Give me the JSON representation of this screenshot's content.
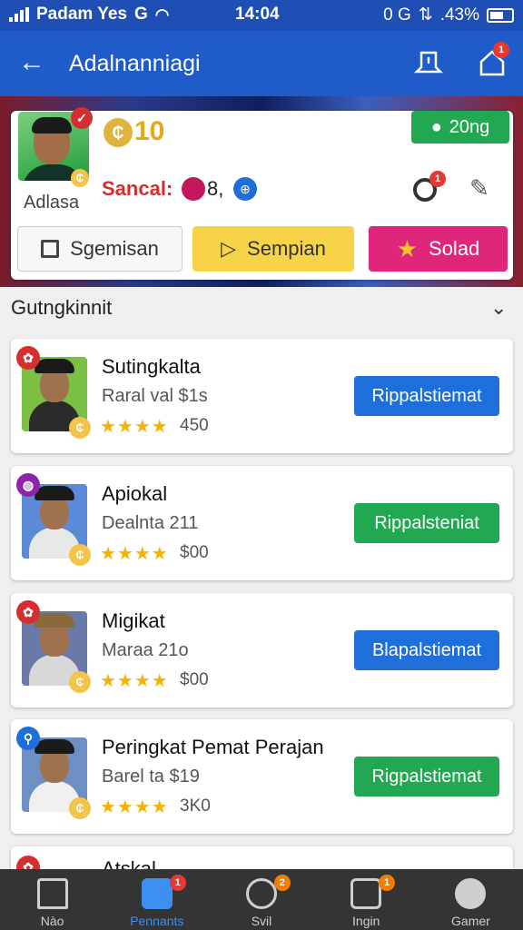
{
  "status": {
    "carrier": "Padam Yes",
    "net": "G",
    "time": "14:04",
    "right_net": "0 G",
    "battery": ".43%"
  },
  "appbar": {
    "title": "Adalnanniagi",
    "notif_badge": "1"
  },
  "profile": {
    "name": "Adlasa",
    "coins": "10",
    "level_badge": "20ng",
    "stats_label": "Sancal:",
    "stats_value": "8,",
    "circle_badge": "1",
    "buttons": [
      {
        "label": "Sgemisan",
        "icon": "checkbox-icon"
      },
      {
        "label": "Sempian",
        "icon": "play-icon"
      },
      {
        "label": "Solad",
        "icon": "star-icon"
      }
    ]
  },
  "section": {
    "title": "Gutngkinnit"
  },
  "items": [
    {
      "title": "Sutingkalta",
      "subtitle": "Raral val $1s",
      "stars": "★★★★",
      "rating": "450",
      "action": "Rippalstiemat",
      "action_color": "#1e6fd9",
      "cat_color": "#d32f2f",
      "cat_icon": "rose-icon",
      "bg": "#7cc043",
      "shirt": "#2b2b2b"
    },
    {
      "title": "Apiokal",
      "subtitle": "Dealnta 211",
      "stars": "★★★★",
      "rating": "$00",
      "action": "Rippalsteniat",
      "action_color": "#21a851",
      "cat_color": "#8e24aa",
      "cat_icon": "apple-icon",
      "bg": "#5a8ad8",
      "shirt": "#e8e8e8"
    },
    {
      "title": "Migikat",
      "subtitle": "Maraa 21o",
      "stars": "★★★★",
      "rating": "$00",
      "action": "Blapalstiemat",
      "action_color": "#1e6fd9",
      "cat_color": "#d32f2f",
      "cat_icon": "rose-icon",
      "bg": "#6a7aa8",
      "shirt": "#d8d8d8"
    },
    {
      "title": "Peringkat Pemat Perajan",
      "subtitle": "Barel ta  $19",
      "stars": "★★★★",
      "rating": "3K0",
      "action": "Rigpalstiemat",
      "action_color": "#21a851",
      "cat_color": "#1e6fd9",
      "cat_icon": "runner-icon",
      "bg": "#6d8fc4",
      "shirt": "#efefef"
    }
  ],
  "partial_item": {
    "title": "Atskal"
  },
  "nav": [
    {
      "label": "Nào",
      "badge": ""
    },
    {
      "label": "Pennants",
      "badge": "1"
    },
    {
      "label": "Svil",
      "badge": "2"
    },
    {
      "label": "Ingin",
      "badge": "1"
    },
    {
      "label": "Gamer",
      "badge": ""
    }
  ]
}
